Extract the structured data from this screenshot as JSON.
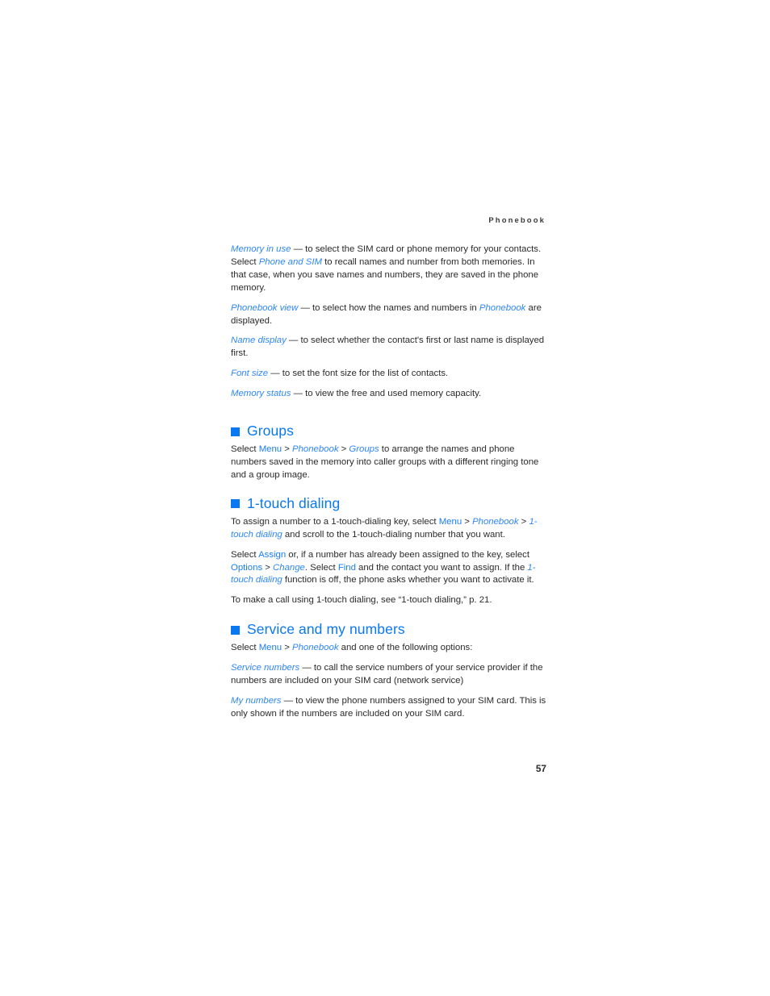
{
  "page": {
    "running_head": "Phonebook",
    "folio": "57",
    "accent_blue": "#0a78f0",
    "link_blue": "#1a7ef2",
    "term_blue": "#2f87f5",
    "body_color": "#2b2b2b"
  },
  "intro": {
    "memory_in_use": {
      "term": "Memory in use",
      "dash": " — ",
      "text_1": "to select the SIM card or phone memory for your contacts. Select ",
      "link_1": "Phone and SIM",
      "text_2": " to recall names and number from both memories. In that case, when you save names and numbers, they are saved in the phone memory."
    },
    "phonebook_view": {
      "term": "Phonebook view",
      "dash": " — ",
      "text_1": "to select how the names and numbers in ",
      "link_1": "Phonebook",
      "text_2": " are displayed."
    },
    "name_display": {
      "term": "Name display",
      "dash": " — ",
      "text_1": "to select whether the contact's first or last name is displayed first."
    },
    "font_size": {
      "term": "Font size",
      "dash": " — ",
      "text_1": "to set the font size for the list of contacts."
    },
    "memory_status": {
      "term": "Memory status",
      "dash": " — ",
      "text_1": "to view the free and used memory capacity."
    }
  },
  "groups": {
    "heading": "Groups",
    "body": {
      "text_1": "Select ",
      "link_1": "Menu",
      "sep_1": " > ",
      "link_2": "Phonebook",
      "sep_2": " > ",
      "link_3": "Groups",
      "text_2": " to arrange the names and phone numbers saved in the memory into caller groups with a different ringing tone and a group image."
    }
  },
  "touch_dialing": {
    "heading": "1-touch dialing",
    "para_1": {
      "text_1": "To assign a number to a 1-touch-dialing key, select ",
      "link_1": "Menu",
      "sep_1": " > ",
      "link_2": "Phonebook",
      "sep_2": " > ",
      "link_3": "1-touch dialing",
      "text_2": " and scroll to the 1-touch-dialing number that you want."
    },
    "para_2": {
      "text_1": "Select ",
      "link_1": "Assign",
      "text_2": " or, if a number has already been assigned to the key, select ",
      "link_2": "Options",
      "sep_1": " > ",
      "link_3": "Change",
      "text_3": ". Select ",
      "link_4": "Find",
      "text_4": " and the contact you want to assign. If the ",
      "link_5": "1-touch dialing",
      "text_5": " function is off, the phone asks whether you want to activate it."
    },
    "para_3": {
      "text_1": "To make a call using 1-touch dialing, see “1-touch dialing,” p. 21."
    }
  },
  "service": {
    "heading": "Service and my numbers",
    "intro": {
      "text_1": "Select ",
      "link_1": "Menu",
      "sep_1": " > ",
      "link_2": "Phonebook",
      "text_2": " and one of the following options:"
    },
    "service_numbers": {
      "term": "Service numbers",
      "dash": " — ",
      "text_1": "to call the service numbers of your service provider if the numbers are included on your SIM card (network service)"
    },
    "my_numbers": {
      "term": "My numbers",
      "dash": " — ",
      "text_1": "to view the phone numbers assigned to your SIM card. This is only shown if the numbers are included on your SIM card."
    }
  }
}
